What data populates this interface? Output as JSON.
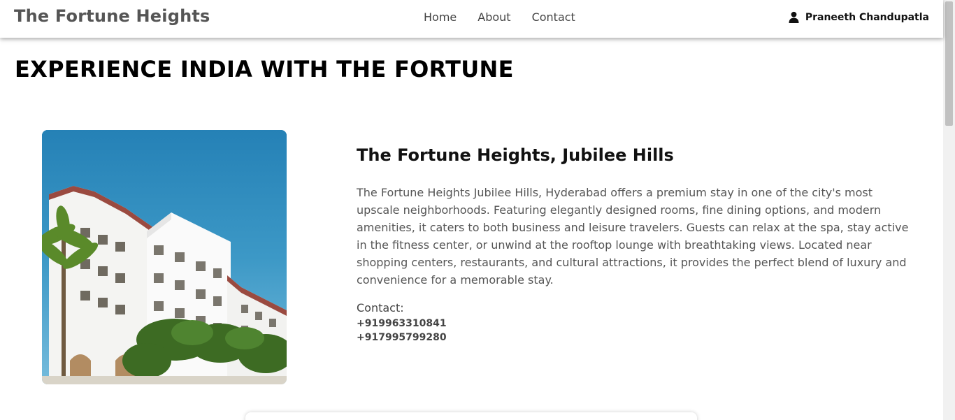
{
  "navbar": {
    "brand": "The Fortune Heights",
    "links": [
      "Home",
      "About",
      "Contact"
    ],
    "user": {
      "icon": "user-icon",
      "name": "Praneeth Chandupatla"
    }
  },
  "main": {
    "title": "EXPERIENCE INDIA WITH THE FORTUNE",
    "hotel": {
      "name": "The Fortune Heights, Jubilee Hills",
      "description": "The Fortune Heights Jubilee Hills, Hyderabad offers a premium stay in one of the city's most upscale neighborhoods. Featuring elegantly designed rooms, fine dining options, and modern amenities, it caters to both business and leisure travelers. Guests can relax at the spa, stay active in the fitness center, or unwind at the rooftop lounge with breathtaking views. Located near shopping centers, restaurants, and cultural attractions, it provides the perfect blend of luxury and convenience for a memorable stay.",
      "contact_label": "Contact:",
      "phones": [
        "+919963310841",
        "+917995799280"
      ]
    }
  },
  "colors": {
    "brand_text": "#555555",
    "body_text": "#555555",
    "sky": "#2a86b9"
  }
}
